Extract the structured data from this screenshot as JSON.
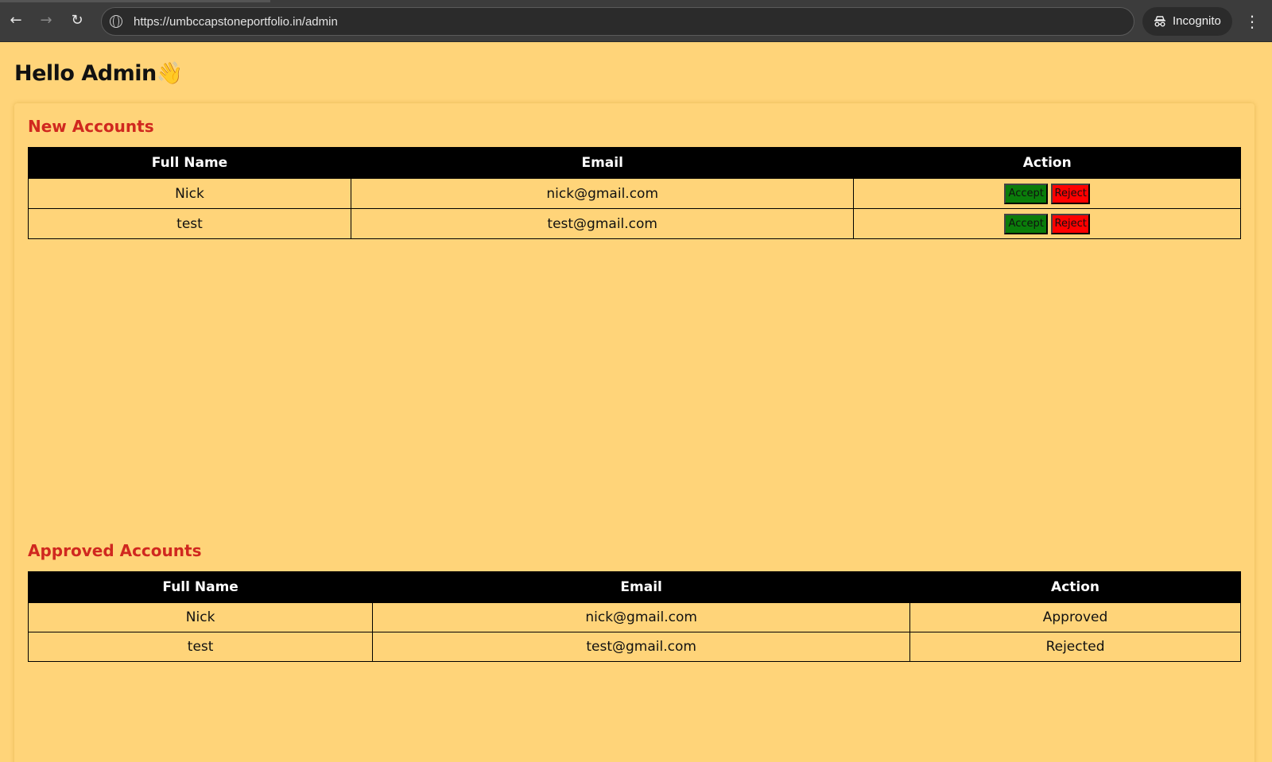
{
  "browser": {
    "url": "https://umbccapstoneportfolio.in/admin",
    "incognito_label": "Incognito"
  },
  "page": {
    "greeting": "Hello Admin👋"
  },
  "new_accounts": {
    "title": "New Accounts",
    "headers": [
      "Full Name",
      "Email",
      "Action"
    ],
    "rows": [
      {
        "name": "Nick",
        "email": "nick@gmail.com",
        "accept": "Accept",
        "reject": "Reject"
      },
      {
        "name": "test",
        "email": "test@gmail.com",
        "accept": "Accept",
        "reject": "Reject"
      }
    ]
  },
  "approved_accounts": {
    "title": "Approved Accounts",
    "headers": [
      "Full Name",
      "Email",
      "Action"
    ],
    "rows": [
      {
        "name": "Nick",
        "email": "nick@gmail.com",
        "status": "Approved"
      },
      {
        "name": "test",
        "email": "test@gmail.com",
        "status": "Rejected"
      }
    ]
  },
  "colors": {
    "page_background": "#ffd479",
    "section_title": "#d0281f",
    "accept_button": "#0a7d0a",
    "reject_button": "#ff0000"
  }
}
